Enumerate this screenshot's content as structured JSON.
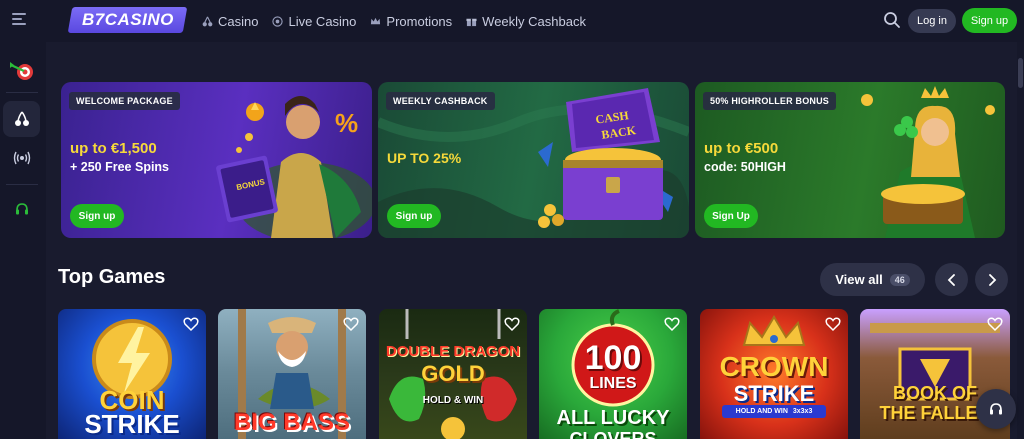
{
  "brand": {
    "logo_text": "B7CASINO"
  },
  "nav": [
    {
      "label": "Casino",
      "icon": "cherries-icon"
    },
    {
      "label": "Live Casino",
      "icon": "live-icon"
    },
    {
      "label": "Promotions",
      "icon": "crown-icon"
    },
    {
      "label": "Weekly Cashback",
      "icon": "gift-icon"
    }
  ],
  "header": {
    "login_label": "Log in",
    "signup_label": "Sign up"
  },
  "sidebar": {
    "items": [
      {
        "name": "target-icon",
        "active": false
      },
      {
        "name": "cherries-icon",
        "active": true
      },
      {
        "name": "broadcast-icon",
        "active": false
      },
      {
        "name": "headset-icon",
        "active": false
      }
    ]
  },
  "banners": [
    {
      "tag": "WELCOME PACKAGE",
      "headline": "up to €1,500",
      "sub": "+ 250 Free Spins",
      "button": "Sign up",
      "color": "#4a2aa8"
    },
    {
      "tag": "WEEKLY CASHBACK",
      "headline": "UP TO 25%",
      "sub": "",
      "button": "Sign up",
      "color": "#1f5a3a"
    },
    {
      "tag": "50% HIGHROLLER BONUS",
      "headline": "up to €500",
      "sub": "code: 50HIGH",
      "button": "Sign Up",
      "color": "#2b7a2a"
    }
  ],
  "banner_art": {
    "chest_text_1": "CASH",
    "chest_text_2": "BACK",
    "book_text": "BONUS"
  },
  "top_games": {
    "title": "Top Games",
    "view_all_label": "View all",
    "count": "46"
  },
  "games": [
    {
      "line1": "COIN",
      "line2": "STRIKE",
      "color": "#1a4fd0"
    },
    {
      "line1": "BIG BASS",
      "line2": "",
      "color": "#6a8a9a"
    },
    {
      "line1": "DOUBLE DRAGON",
      "line2": "GOLD",
      "line3": "HOLD & WIN",
      "color": "#2b3a1a"
    },
    {
      "line1": "100",
      "line2": "LINES",
      "line3": "ALL LUCKY",
      "line4": "CLOVERS",
      "color": "#2aa83a"
    },
    {
      "line1": "CROWN",
      "line2": "STRIKE",
      "line3": "HOLD AND WIN",
      "line4": "3x3x3",
      "color": "#c72a14"
    },
    {
      "line1": "BOOK OF",
      "line2": "THE FALLEN",
      "color": "#7a4a22"
    }
  ]
}
